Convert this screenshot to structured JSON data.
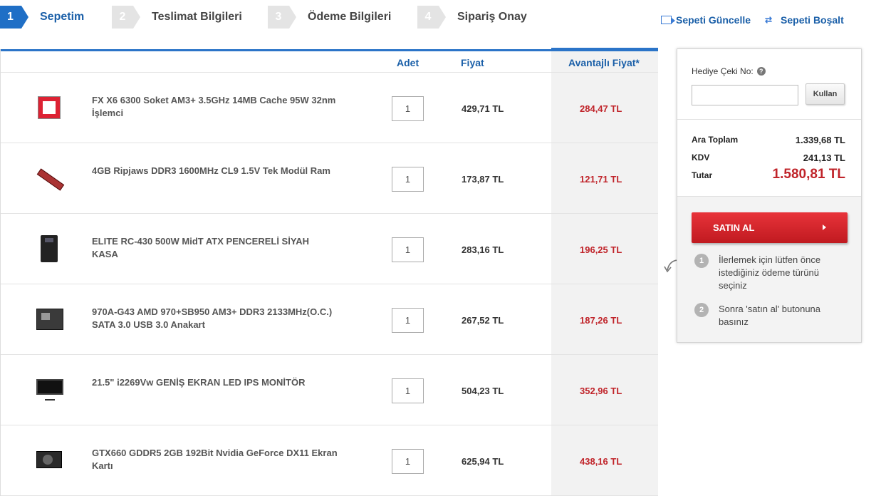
{
  "steps": [
    {
      "num": "1",
      "label": "Sepetim"
    },
    {
      "num": "2",
      "label": "Teslimat Bilgileri"
    },
    {
      "num": "3",
      "label": "Ödeme Bilgileri"
    },
    {
      "num": "4",
      "label": "Sipariş Onay"
    }
  ],
  "actions": {
    "update": "Sepeti Güncelle",
    "empty": "Sepeti Boşalt"
  },
  "table": {
    "headers": {
      "qty": "Adet",
      "price": "Fiyat",
      "adv_price": "Avantajlı Fiyat*"
    },
    "rows": [
      {
        "name": "FX X6 6300 Soket AM3+ 3.5GHz 14MB Cache 95W 32nm İşlemci",
        "qty": "1",
        "price": "429,71 TL",
        "adv": "284,47 TL"
      },
      {
        "name": "4GB Ripjaws DDR3 1600MHz CL9 1.5V Tek Modül Ram",
        "qty": "1",
        "price": "173,87 TL",
        "adv": "121,71 TL"
      },
      {
        "name": "ELITE RC-430 500W MidT ATX PENCERELİ SİYAH KASA",
        "qty": "1",
        "price": "283,16 TL",
        "adv": "196,25 TL"
      },
      {
        "name": "970A-G43 AMD 970+SB950 AM3+ DDR3 2133MHz(O.C.) SATA 3.0 USB 3.0 Anakart",
        "qty": "1",
        "price": "267,52 TL",
        "adv": "187,26 TL"
      },
      {
        "name": "21.5\" i2269Vw GENİŞ EKRAN LED IPS MONİTÖR",
        "qty": "1",
        "price": "504,23 TL",
        "adv": "352,96 TL"
      },
      {
        "name": "GTX660 GDDR5 2GB 192Bit Nvidia GeForce DX11 Ekran Kartı",
        "qty": "1",
        "price": "625,94 TL",
        "adv": "438,16 TL"
      }
    ]
  },
  "sidebar": {
    "gift_label": "Hediye Çeki No:",
    "help": "?",
    "use_button": "Kullan",
    "subtotal_label": "Ara Toplam",
    "subtotal": "1.339,68 TL",
    "vat_label": "KDV",
    "vat": "241,13 TL",
    "total_label": "Tutar",
    "total": "1.580,81 TL",
    "buy_button": "SATIN AL",
    "instructions": [
      {
        "num": "1",
        "text": "İlerlemek için lütfen önce istediğiniz ödeme türünü seçiniz"
      },
      {
        "num": "2",
        "text": "Sonra 'satın al' butonuna basınız"
      }
    ]
  },
  "colors": {
    "accent": "#1f6fc6",
    "price_red": "#c0242a",
    "buy_red": "#d4262c"
  }
}
